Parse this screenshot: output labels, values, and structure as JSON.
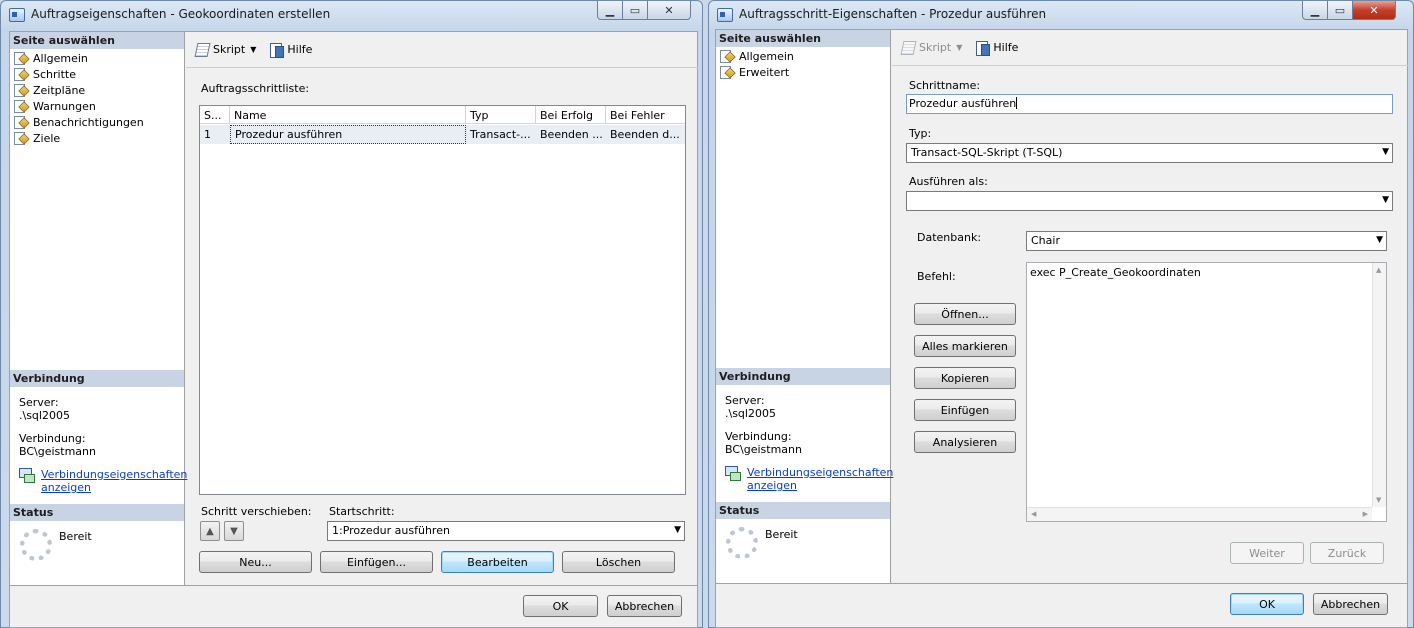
{
  "win1": {
    "title": "Auftragseigenschaften - Geokoordinaten erstellen",
    "nav": {
      "header": "Seite auswählen",
      "items": [
        "Allgemein",
        "Schritte",
        "Zeitpläne",
        "Warnungen",
        "Benachrichtigungen",
        "Ziele"
      ]
    },
    "connection": {
      "header": "Verbindung",
      "server_label": "Server:",
      "server_value": ".\\sql2005",
      "conn_label": "Verbindung:",
      "conn_value": "BC\\geistmann",
      "link_line1": "Verbindungseigenschaften",
      "link_line2": "anzeigen"
    },
    "status": {
      "header": "Status",
      "text": "Bereit"
    },
    "toolbar": {
      "script": "Skript",
      "help": "Hilfe"
    },
    "steps_label": "Auftragsschrittliste:",
    "grid": {
      "headers": [
        "S...",
        "Name",
        "Typ",
        "Bei Erfolg",
        "Bei Fehler"
      ],
      "rows": [
        {
          "step": "1",
          "name": "Prozedur ausführen",
          "type": "Transact-...",
          "success": "Beenden ...",
          "failure": "Beenden d..."
        }
      ]
    },
    "move_label": "Schritt verschieben:",
    "start_label": "Startschritt:",
    "start_value": "1:Prozedur ausführen",
    "buttons": {
      "new": "Neu...",
      "insert": "Einfügen...",
      "edit": "Bearbeiten",
      "delete": "Löschen"
    },
    "ok": "OK",
    "cancel": "Abbrechen"
  },
  "win2": {
    "title": "Auftragsschritt-Eigenschaften - Prozedur ausführen",
    "nav": {
      "header": "Seite auswählen",
      "items": [
        "Allgemein",
        "Erweitert"
      ]
    },
    "connection": {
      "header": "Verbindung",
      "server_label": "Server:",
      "server_value": ".\\sql2005",
      "conn_label": "Verbindung:",
      "conn_value": "BC\\geistmann",
      "link_line1": "Verbindungseigenschaften",
      "link_line2": "anzeigen"
    },
    "status": {
      "header": "Status",
      "text": "Bereit"
    },
    "toolbar": {
      "script": "Skript",
      "help": "Hilfe"
    },
    "step_name_label": "Schrittname:",
    "step_name_value": "Prozedur ausführen",
    "type_label": "Typ:",
    "type_value": "Transact-SQL-Skript (T-SQL)",
    "run_as_label": "Ausführen als:",
    "run_as_value": "",
    "database_label": "Datenbank:",
    "database_value": "Chair",
    "command_label": "Befehl:",
    "command_value": "exec P_Create_Geokoordinaten",
    "side_buttons": [
      "Öffnen...",
      "Alles markieren",
      "Kopieren",
      "Einfügen",
      "Analysieren"
    ],
    "next": "Weiter",
    "back": "Zurück",
    "ok": "OK",
    "cancel": "Abbrechen"
  }
}
